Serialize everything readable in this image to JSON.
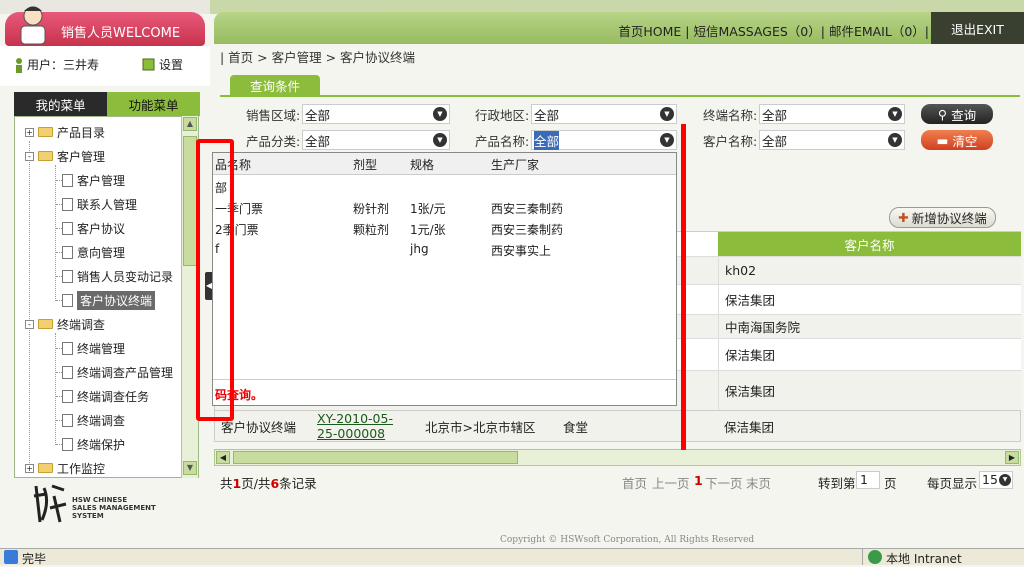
{
  "header": {
    "welcome": "销售人员WELCOME",
    "nav": [
      "首页HOME |",
      "短信MASSAGES（0）|",
      "邮件EMAIL（0）|"
    ],
    "exit": "退出EXIT"
  },
  "user": {
    "label": "用户：三井寿",
    "settings": "设置"
  },
  "menu_tabs": {
    "my": "我的菜单",
    "func": "功能菜单"
  },
  "tree": {
    "products": "产品目录",
    "customer_mgmt": "客户管理",
    "items1": [
      "客户管理",
      "联系人管理",
      "客户协议",
      "意向管理",
      "销售人员变动记录",
      "客户协议终端"
    ],
    "terminal_survey": "终端调查",
    "items2": [
      "终端管理",
      "终端调查产品管理",
      "终端调查任务",
      "终端调查",
      "终端保护"
    ],
    "work_monitor": "工作监控"
  },
  "brand": {
    "line1": "HSW CHINESE",
    "line2": "SALES MANAGEMENT",
    "line3": "SYSTEM"
  },
  "breadcrumb": "| 首页 > 客户管理 > 客户协议终端",
  "query_tab": "查询条件",
  "filters": {
    "sales_region_label": "销售区域:",
    "sales_region": "全部",
    "admin_region_label": "行政地区:",
    "admin_region": "全部",
    "terminal_name_label": "终端名称:",
    "terminal_name": "全部",
    "category_label": "产品分类:",
    "category": "全部",
    "product_name_label": "产品名称:",
    "product_name": "全部",
    "customer_name_label": "客户名称:",
    "customer_name": "全部"
  },
  "buttons": {
    "query": "查询",
    "clear": "清空",
    "add": "新增协议终端"
  },
  "popup": {
    "headers": [
      "品名称",
      "剂型",
      "规格",
      "生产厂家"
    ],
    "first": "部",
    "rows": [
      [
        "一季门票",
        "粉针剂",
        "1张/元",
        "西安三秦制药"
      ],
      [
        "2季门票",
        "颗粒剂",
        "1元/张",
        "西安三秦制药"
      ],
      [
        "f",
        "",
        "jhg",
        "西安事实上"
      ]
    ],
    "footer": "码查询。"
  },
  "grid": {
    "header": "客户名称",
    "customers": [
      "kh02",
      "保洁集团",
      "中南海国务院",
      "保洁集团",
      "保洁集团"
    ],
    "last_row": {
      "type": "客户协议终端",
      "code": "XY-2010-05-25-000008",
      "region": "北京市>北京市辖区",
      "kind": "食堂",
      "customer": "保洁集团"
    }
  },
  "pager": {
    "summary_pre": "共",
    "pages": "1",
    "mid": "页/共",
    "count": "6",
    "post": "条记录",
    "first": "首页",
    "prev": "上一页",
    "current": "1",
    "next": "下一页",
    "last": "末页",
    "goto": "转到第",
    "goto_val": "1",
    "page_unit": "页",
    "per_page": "每页显示",
    "per_page_val": "15"
  },
  "copyright": "Copyright © HSWsoft Corporation, All Rights Reserved",
  "status": {
    "done": "完毕",
    "zone": "本地 Intranet"
  }
}
